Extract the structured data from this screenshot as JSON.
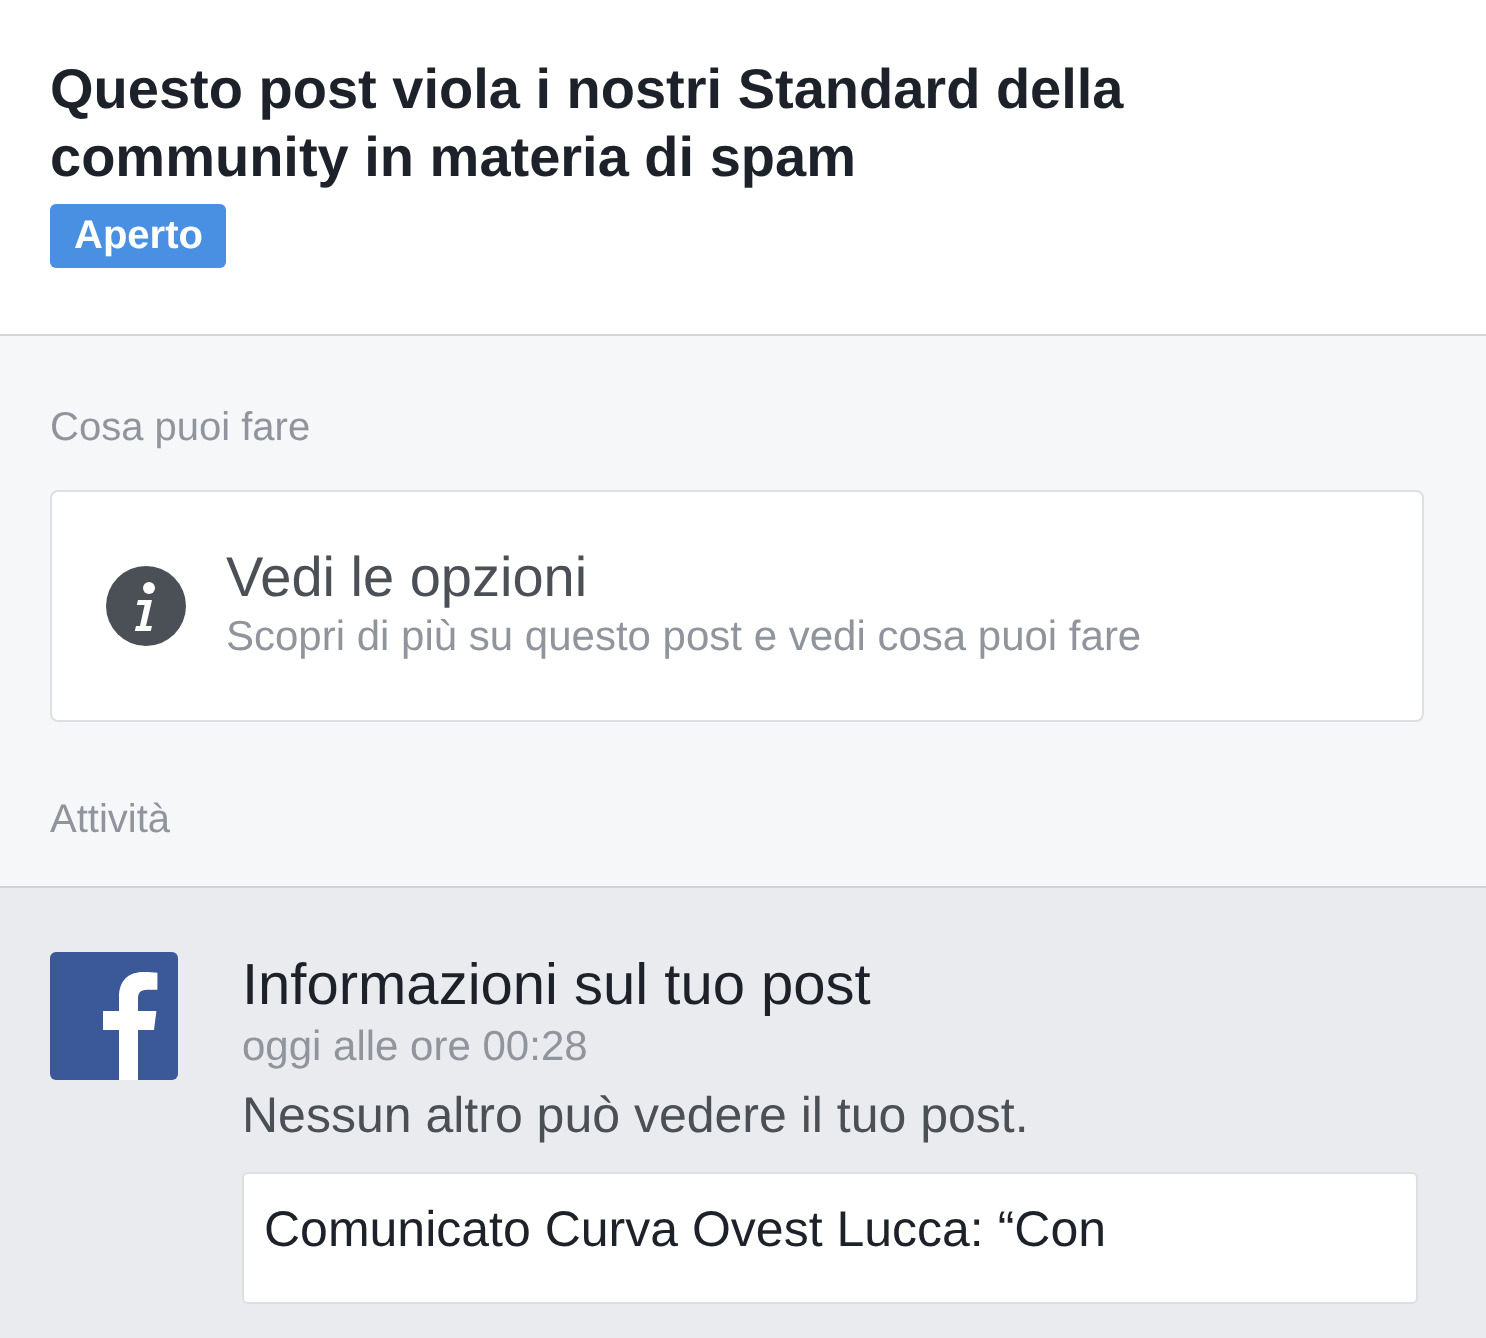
{
  "header": {
    "title": "Questo post viola i nostri Standard della community in materia di spam",
    "status": {
      "label": "Aperto",
      "kind": "open"
    }
  },
  "options_section": {
    "heading": "Cosa puoi fare",
    "card": {
      "title": "Vedi le opzioni",
      "subtitle": "Scopri di più su questo post e vedi cosa puoi fare"
    }
  },
  "activity_section": {
    "heading": "Attività",
    "items": [
      {
        "kind": "facebook",
        "title": "Informazioni sul tuo post",
        "time": "oggi alle ore 00:28",
        "message": "Nessun altro può vedere il tuo post.",
        "quote": "Comunicato Curva Ovest Lucca: “Con"
      }
    ]
  }
}
